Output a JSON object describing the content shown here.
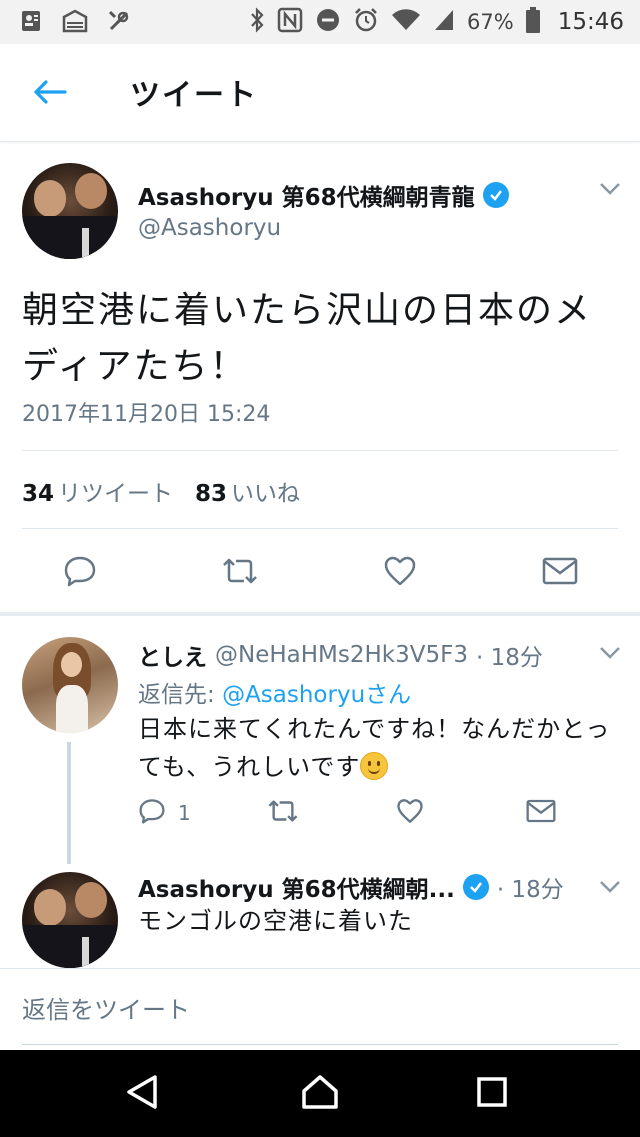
{
  "status_bar": {
    "battery_percent": "67%",
    "clock": "15:46",
    "icons_left": [
      "contacts-card-icon",
      "inbox-icon",
      "tools-icon"
    ],
    "icons_right": [
      "bluetooth-icon",
      "nfc-icon",
      "do-not-disturb-icon",
      "alarm-icon",
      "wifi-icon",
      "signal-icon",
      "battery-icon"
    ]
  },
  "header": {
    "title": "ツイート"
  },
  "tweet": {
    "author_name": "Asashoryu 第68代横綱朝青龍",
    "handle": "@Asashoryu",
    "verified": true,
    "text": "朝空港に着いたら沢山の日本のメディアたち！",
    "timestamp": "2017年11月20日 15:24",
    "retweet_count": "34",
    "retweet_label": "リツイート",
    "like_count": "83",
    "like_label": "いいね"
  },
  "replies": [
    {
      "name": "としえ",
      "handle": "@NeHaHMs2Hk3V5F3",
      "time": "· 18分",
      "reply_to_prefix": "返信先: ",
      "reply_to_handle": "@Asashoryuさん",
      "text": "日本に来てくれたんですね！なんだかとっても、うれしいです",
      "reply_count": "1"
    },
    {
      "name": "Asashoryu 第68代横綱朝...",
      "verified": true,
      "time": "· 18分",
      "text": "モンゴルの空港に着いた"
    }
  ],
  "reply_box": {
    "placeholder": "返信をツイート"
  },
  "colors": {
    "accent": "#1da1f2",
    "secondary_text": "#657786",
    "divider": "#e1e8ed"
  }
}
